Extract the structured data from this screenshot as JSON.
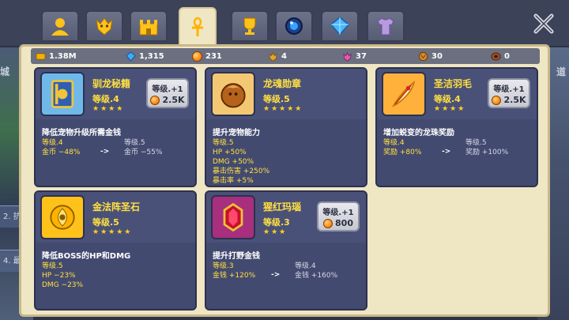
{
  "background": {
    "left_label": "城",
    "right_label": "道",
    "rows": [
      "2. 抗",
      "3. ",
      "4. 最后"
    ]
  },
  "tabs": [
    {
      "icon": "user-icon",
      "active": false
    },
    {
      "icon": "dragon-head-icon",
      "active": false
    },
    {
      "icon": "castle-icon",
      "active": false
    },
    {
      "icon": "ankh-icon",
      "active": true
    },
    {
      "icon": "trophy-icon",
      "active": false
    },
    {
      "icon": "orb-icon",
      "active": false
    },
    {
      "icon": "diamond-icon",
      "active": false
    },
    {
      "icon": "shirt-icon",
      "active": false
    }
  ],
  "resources": [
    {
      "icon": "gold-bar-icon",
      "value": "1.38M"
    },
    {
      "icon": "gem-icon",
      "value": "1,315"
    },
    {
      "icon": "orange-coin-icon",
      "value": "231"
    },
    {
      "icon": "dragon-token-icon",
      "value": "4"
    },
    {
      "icon": "pink-token-icon",
      "value": "37"
    },
    {
      "icon": "claw-token-icon",
      "value": "30"
    },
    {
      "icon": "egg-token-icon",
      "value": "0"
    }
  ],
  "cards": [
    {
      "name": "驯龙秘籍",
      "level": "等级.4",
      "stars": "★★★★",
      "has_upgrade": true,
      "upgrade_label": "等级.+1",
      "cost": "2.5K",
      "description": "降低宠物升级所需金钱",
      "current": [
        "等级.4",
        "金币 −48%"
      ],
      "next": [
        "等级.5",
        "金币 −55%"
      ],
      "arrow": "->",
      "icon": "book-icon"
    },
    {
      "name": "龙魂勋章",
      "level": "等级.5",
      "stars": "★★★★★",
      "has_upgrade": false,
      "description": "提升宠物能力",
      "current": [
        "等级.5",
        "HP +50%",
        "DMG +50%",
        "暴击伤害 +250%",
        "暴击率 +5%"
      ],
      "next": [],
      "arrow": "",
      "icon": "dragon-medal-icon"
    },
    {
      "name": "圣洁羽毛",
      "level": "等级.4",
      "stars": "★★★★",
      "has_upgrade": true,
      "upgrade_label": "等级.+1",
      "cost": "2.5K",
      "description": "增加蜕变的龙珠奖励",
      "current": [
        "等级.4",
        "奖励 +80%"
      ],
      "next": [
        "等级.5",
        "奖励 +100%"
      ],
      "arrow": "->",
      "icon": "feather-icon"
    },
    {
      "name": "金法阵圣石",
      "level": "等级.5",
      "stars": "★★★★★",
      "has_upgrade": false,
      "description": "降低BOSS的HP和DMG",
      "current": [
        "等级.5",
        "HP −23%",
        "DMG −23%"
      ],
      "next": [],
      "arrow": "",
      "icon": "gold-rune-icon"
    },
    {
      "name": "猩红玛瑙",
      "level": "等级.3",
      "stars": "★★★",
      "has_upgrade": true,
      "upgrade_label": "等级.+1",
      "cost": "800",
      "description": "提升打野金钱",
      "current": [
        "等级.3",
        "金钱 +120%"
      ],
      "next": [
        "等级.4",
        "金钱 +160%"
      ],
      "arrow": "->",
      "icon": "red-agate-icon"
    }
  ],
  "colors": {
    "panel": "#efe6c4",
    "card": "#434a70",
    "highlight_yellow": "#ffe040"
  }
}
